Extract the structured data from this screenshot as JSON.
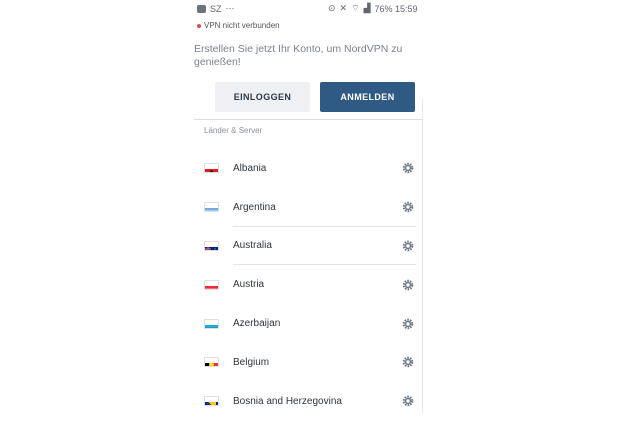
{
  "status_bar": {
    "left_text": "SZ",
    "right_text": "76% 15:59"
  },
  "connection_status": "VPN nicht verbunden",
  "promo_text": "Erstellen Sie jetzt Ihr Konto, um NordVPN zu genießen!",
  "buttons": {
    "login": "EINLOGGEN",
    "signup": "ANMELDEN"
  },
  "section_title": "Länder & Server",
  "countries": [
    {
      "name": "Albania",
      "flag": "albania-flag-icon"
    },
    {
      "name": "Argentina",
      "flag": "argentina-flag-icon"
    },
    {
      "name": "Australia",
      "flag": "australia-flag-icon"
    },
    {
      "name": "Austria",
      "flag": "austria-flag-icon"
    },
    {
      "name": "Azerbaijan",
      "flag": "azerbaijan-flag-icon"
    },
    {
      "name": "Belgium",
      "flag": "belgium-flag-icon"
    },
    {
      "name": "Bosnia and Herzegovina",
      "flag": "bosnia-flag-icon"
    }
  ],
  "colors": {
    "primary_button": "#2f5a84",
    "secondary_button": "#eef0f3",
    "disconnected_dot": "#e24b4b"
  }
}
